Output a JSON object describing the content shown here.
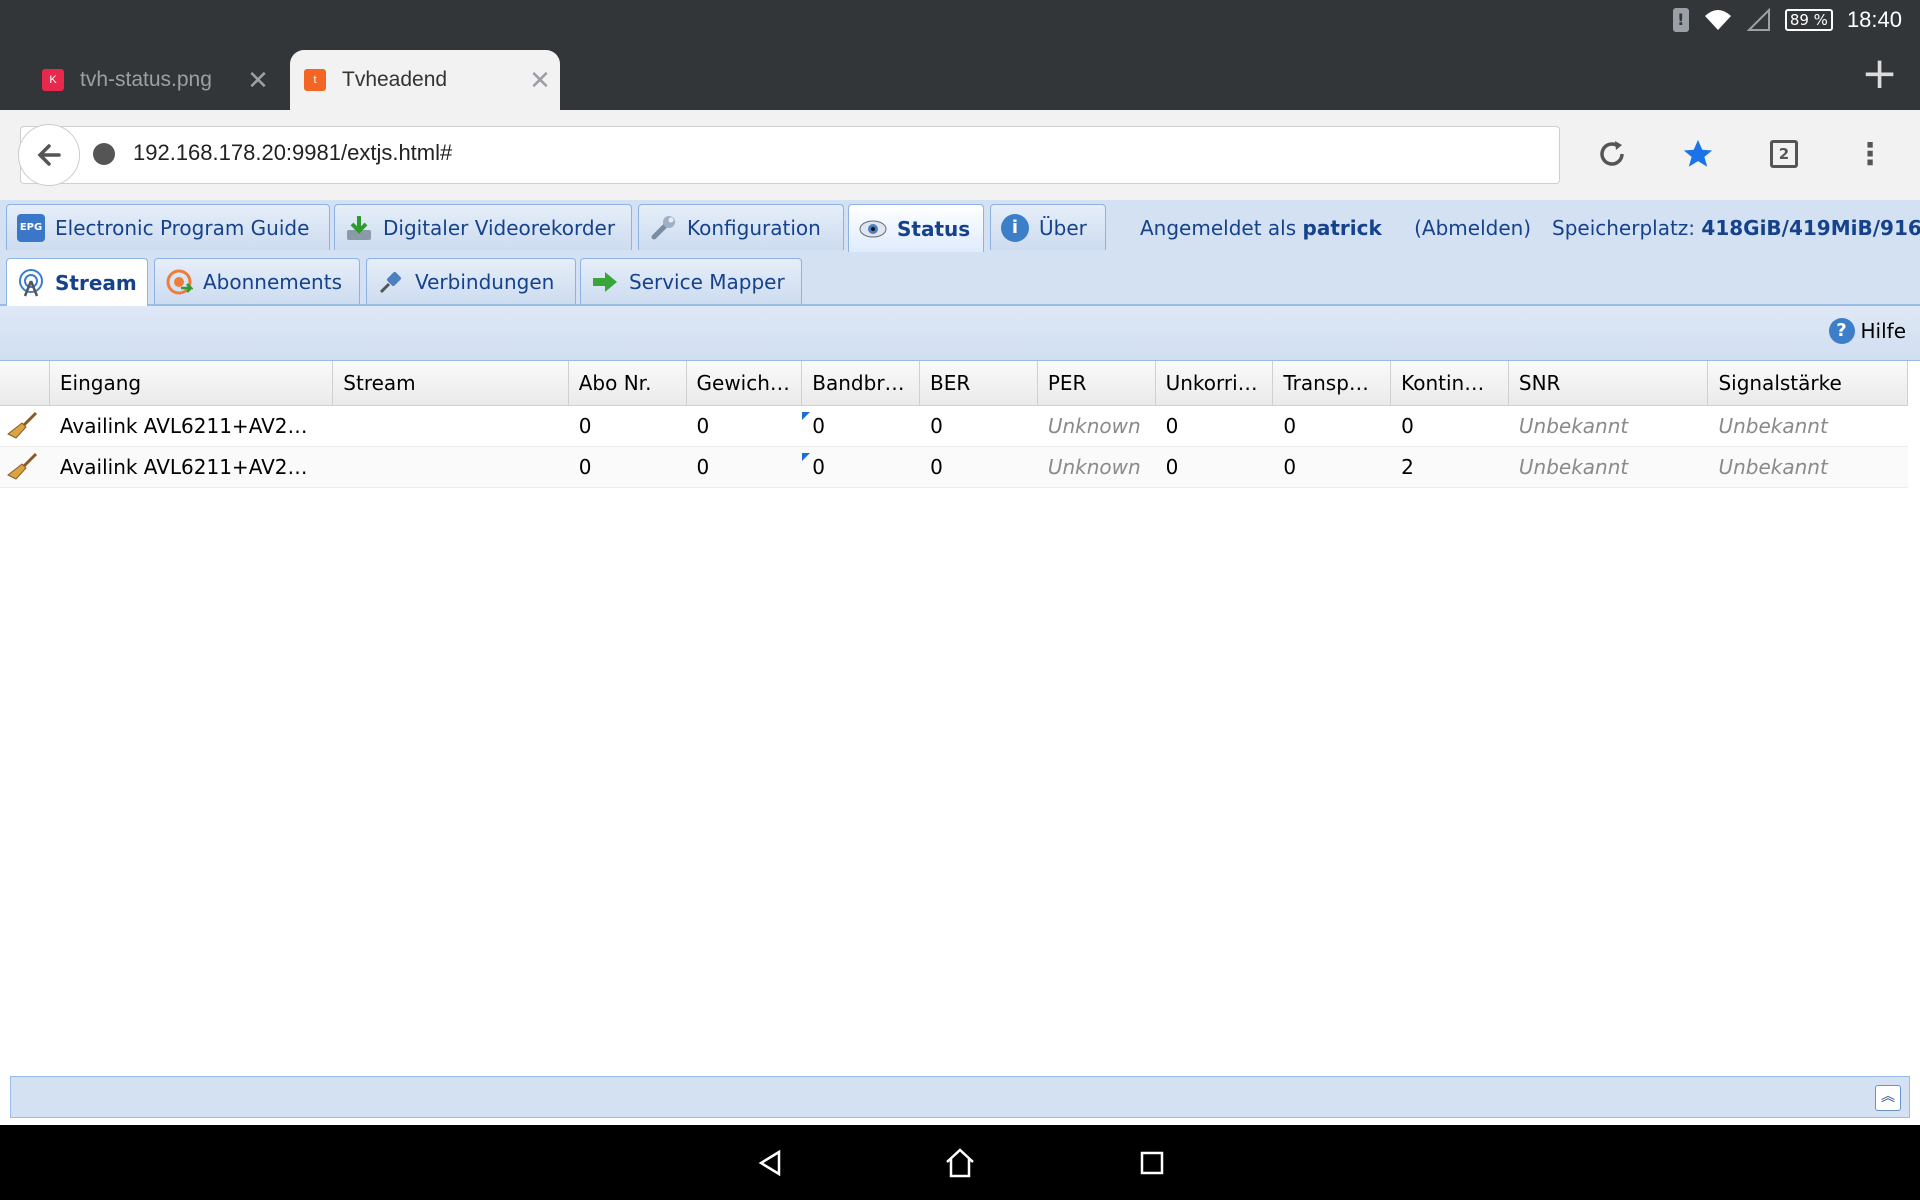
{
  "system_status": {
    "battery": "89 %",
    "time": "18:40"
  },
  "browser": {
    "tabs": [
      {
        "title": "tvh-status.png",
        "favicon_letter": "K",
        "favicon_color": "#e8294d",
        "active": false
      },
      {
        "title": "Tvheadend",
        "favicon_letter": "t",
        "favicon_color": "#f26522",
        "active": true
      }
    ],
    "new_tab_label": "+",
    "url": "192.168.178.20:9981/extjs.html#",
    "tab_count": "2",
    "bookmark_color": "#1a73e8"
  },
  "app": {
    "main_tabs": [
      {
        "label": "Electronic Program Guide",
        "icon": "epg-icon"
      },
      {
        "label": "Digitaler Videorekorder",
        "icon": "dvr-download-icon"
      },
      {
        "label": "Konfiguration",
        "icon": "wrench-icon"
      },
      {
        "label": "Status",
        "icon": "eye-icon"
      },
      {
        "label": "Über",
        "icon": "info-icon"
      }
    ],
    "logged_in_prefix": "Angemeldet als",
    "username": "patrick",
    "logout": "(Abmelden)",
    "storage_label": "Speicherplatz:",
    "storage_value": "418GiB/419MiB/916",
    "sub_tabs": [
      {
        "label": "Stream",
        "icon": "antenna-icon"
      },
      {
        "label": "Abonnements",
        "icon": "subscription-icon"
      },
      {
        "label": "Verbindungen",
        "icon": "plug-icon"
      },
      {
        "label": "Service Mapper",
        "icon": "arrow-right-icon"
      }
    ],
    "help_label": "Hilfe",
    "grid": {
      "columns": [
        "",
        "Eingang",
        "Stream",
        "Abo Nr.",
        "Gewich…",
        "Bandbr…",
        "BER",
        "PER",
        "Unkorri…",
        "Transp…",
        "Kontin…",
        "SNR",
        "Signalstärke"
      ],
      "rows": [
        [
          "",
          "Availink AVL6211+AV2…",
          "",
          "0",
          "0",
          "0",
          "0",
          "Unknown",
          "0",
          "0",
          "0",
          "Unbekannt",
          "Unbekannt"
        ],
        [
          "",
          "Availink AVL6211+AV2…",
          "",
          "0",
          "0",
          "0",
          "0",
          "Unknown",
          "0",
          "0",
          "2",
          "Unbekannt",
          "Unbekannt"
        ]
      ]
    },
    "accent_color": "#15428b",
    "panel_color": "#d4e1f2"
  }
}
